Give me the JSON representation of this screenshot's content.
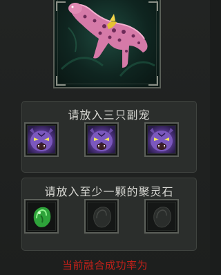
{
  "colors": {
    "panel_bg": "#2b2e2c",
    "slot_border": "#5b5f59",
    "title_text": "#d9d9d4",
    "warning_text": "#c0211a"
  },
  "preview": {
    "subject": "pink-spotted-panther-pet"
  },
  "pets_section": {
    "title": "请放入三只副宠",
    "slots": [
      {
        "filled": true,
        "icon": "purple-tiger-face-icon"
      },
      {
        "filled": true,
        "icon": "purple-tiger-face-icon"
      },
      {
        "filled": true,
        "icon": "purple-tiger-face-icon"
      }
    ]
  },
  "stones_section": {
    "title": "请放入至少一颗的聚灵石",
    "slots": [
      {
        "filled": true,
        "icon": "green-spirit-stone-icon"
      },
      {
        "filled": false,
        "icon": "grey-spirit-stone-placeholder-icon"
      },
      {
        "filled": false,
        "icon": "grey-spirit-stone-placeholder-icon"
      }
    ]
  },
  "footer": {
    "rate_text": "当前融合成功率为"
  }
}
